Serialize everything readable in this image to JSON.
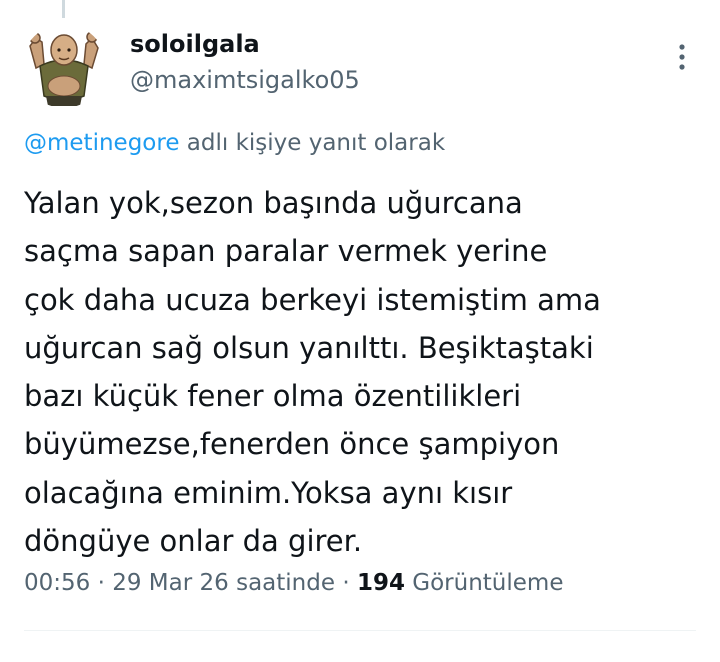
{
  "author": {
    "display_name": "soloilgala",
    "handle": "@maximtsigalko05"
  },
  "reply_context": {
    "mention": "@metinegore",
    "suffix": " adlı kişiye yanıt olarak"
  },
  "tweet": {
    "lines": [
      "Yalan yok,sezon başında uğurcana",
      "saçma sapan paralar vermek yerine",
      "çok daha ucuza berkeyi istemiştim ama",
      "uğurcan sağ olsun yanılttı. Beşiktaştaki",
      "bazı küçük fener olma özentilikleri",
      "büyümezse,fenerden önce şampiyon",
      "olacağına eminim.Yoksa aynı kısır",
      "döngüye onlar da girer."
    ]
  },
  "meta": {
    "time": "00:56",
    "sep1": " · ",
    "date": "29 Mar 26 saatinde",
    "sep2": " · ",
    "view_count": "194",
    "views_label": " Görüntüleme"
  },
  "colors": {
    "text_primary": "#0f1419",
    "text_secondary": "#536471",
    "link": "#1d9bf0",
    "divider": "#eff3f4"
  },
  "icons": {
    "more": "more-options-icon"
  }
}
